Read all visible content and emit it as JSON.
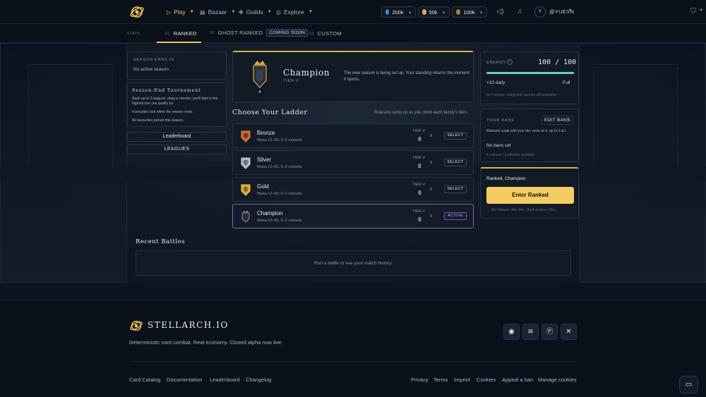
{
  "header": {
    "nav": [
      {
        "label": "Play",
        "icon": "play-icon"
      },
      {
        "label": "Bazaar",
        "icon": "store-icon"
      },
      {
        "label": "Guilds",
        "icon": "guilds-icon"
      },
      {
        "label": "Explore",
        "icon": "compass-icon"
      }
    ],
    "currencies": [
      {
        "value": "200k",
        "color": "#3a8bd6"
      },
      {
        "value": "50k",
        "color": "#d9b04a"
      },
      {
        "value": "100k",
        "color": "#b07a4a"
      }
    ],
    "avatar_letter": "Y",
    "username": "@YUEXN"
  },
  "tabs": {
    "stat_label": "STATS   ",
    "items": [
      {
        "num": "01",
        "label": "RANKED"
      },
      {
        "num": "02",
        "label": "GHOST RANKED",
        "badge": "COMING SOON"
      },
      {
        "num": "03",
        "label": "CUSTOM"
      }
    ]
  },
  "left": {
    "season_label": "SEASON ENDS IN",
    "season_value": "No active season",
    "tournament_title": "Season-End Tournament",
    "tournament_lines": [
      "Rank up to 3 leagues; drag to reorder; you'll fight in the highest one you qualify for.",
      "Favourites lock when the season ends.",
      "No favourites picked this season."
    ],
    "leaderboard": "Leaderboard",
    "leagues": "LEAGUES"
  },
  "champion_card": {
    "title": "Champion",
    "tier": "TIER V",
    "desc": "The new season is being set up. Your standing returns the moment it opens."
  },
  "ladder": {
    "title": "Choose Your Ladder",
    "hint": "Rulesets ramp up as you climb each family's tiers.",
    "rows": [
      {
        "name": "Bronze",
        "sub": "Mana 12–60, 0–2 rulesets",
        "tier": "TIER V",
        "value": "0",
        "extra": "8",
        "action": "SELECT",
        "color": "#c4652f"
      },
      {
        "name": "Silver",
        "sub": "Mana 12–60, 0–2 rulesets",
        "tier": "TIER V",
        "value": "0",
        "extra": "8",
        "action": "SELECT",
        "color": "#a9b2bf"
      },
      {
        "name": "Gold",
        "sub": "Mana 12–60, 0–2 rulesets",
        "tier": "TIER V",
        "value": "0",
        "extra": "8",
        "action": "SELECT",
        "color": "#d9a93a"
      },
      {
        "name": "Champion",
        "sub": "Mana 12–60, 0–2 rulesets",
        "tier": "TIER V",
        "value": "0",
        "extra": "8",
        "action": "ACTIVE",
        "color": "#4a4f5c"
      }
    ]
  },
  "right": {
    "energy_label": "ENERGY",
    "energy_value": "100 / 100",
    "energy_fill": 1.0,
    "energy_rate": "+20 daily",
    "energy_state": "Full",
    "energy_note": "At 0 energy, rating-only queues still available.",
    "bans_label": "YOUR BANS",
    "bans_button": "EDIT BANS",
    "bans_desc": "Rulesets scale with your tier: none at V, up to 3 at I.",
    "bans_value": "No bans set",
    "bans_note": "4 rulesets | 8 affinities possible",
    "queue_label": "Ranked, Champion",
    "queue_button": "Enter Ranked",
    "queue_note": "Bot fallback after 90s. Draft window 100s."
  },
  "recent": {
    "title": "Recent Battles",
    "empty": "Run a battle to see your match history."
  },
  "footer": {
    "brand": "STELLARCH.IO",
    "tagline": "Deterministic card combat. Real economy. Closed alpha now live.",
    "social": [
      "discord-icon",
      "audio-icon",
      "patreon-icon",
      "x-icon"
    ],
    "links_left": [
      "Card Catalog",
      "Documentation",
      "Leaderboard",
      "Changelog"
    ],
    "links_right": [
      "Privacy",
      "Terms",
      "Imprint",
      "Cookies",
      "Appeal a ban",
      "Manage cookies"
    ]
  }
}
